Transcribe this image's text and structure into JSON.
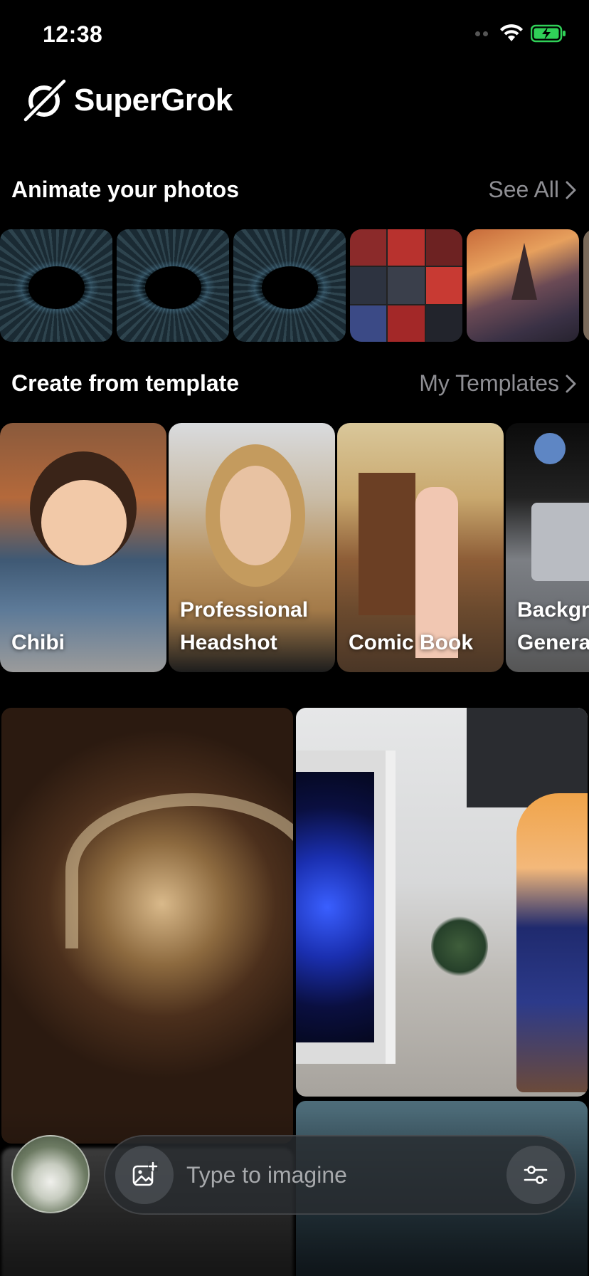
{
  "status_bar": {
    "time": "12:38"
  },
  "brand": {
    "name": "SuperGrok"
  },
  "animate": {
    "title": "Animate your photos",
    "see_all_label": "See All"
  },
  "templates": {
    "title": "Create from template",
    "my_templates_label": "My Templates",
    "items": [
      {
        "label_line1": "Chibi",
        "label_line2": ""
      },
      {
        "label_line1": "Professional",
        "label_line2": "Headshot"
      },
      {
        "label_line1": "Comic Book",
        "label_line2": ""
      },
      {
        "label_line1": "Backgr",
        "label_line2": "Genera"
      }
    ]
  },
  "composer": {
    "placeholder": "Type to imagine"
  },
  "colors": {
    "background": "#000000",
    "secondary_text": "#8e8e93",
    "battery_green": "#30d158"
  }
}
